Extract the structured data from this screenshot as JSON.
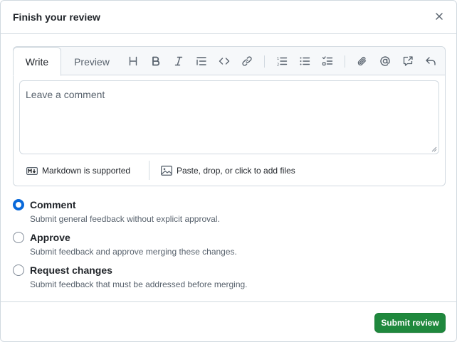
{
  "dialog": {
    "title": "Finish your review",
    "close_icon": "close-icon"
  },
  "editor": {
    "tabs": [
      {
        "label": "Write",
        "active": true
      },
      {
        "label": "Preview",
        "active": false
      }
    ],
    "toolbar": [
      "heading-icon",
      "bold-icon",
      "italic-icon",
      "quote-icon",
      "code-icon",
      "link-icon",
      "ordered-list-icon",
      "unordered-list-icon",
      "task-list-icon",
      "attach-icon",
      "mention-icon",
      "cross-reference-icon",
      "reply-icon"
    ],
    "textarea": {
      "placeholder": "Leave a comment",
      "value": ""
    },
    "footer": {
      "markdown_label": "Markdown is supported",
      "attach_label": "Paste, drop, or click to add files"
    }
  },
  "review_options": [
    {
      "label": "Comment",
      "description": "Submit general feedback without explicit approval.",
      "checked": true
    },
    {
      "label": "Approve",
      "description": "Submit feedback and approve merging these changes.",
      "checked": false
    },
    {
      "label": "Request changes",
      "description": "Submit feedback that must be addressed before merging.",
      "checked": false
    }
  ],
  "actions": {
    "submit_label": "Submit review"
  },
  "colors": {
    "accent": "#0969da",
    "submit_bg": "#1f883d",
    "border": "#d1d9e0",
    "muted_text": "#59636e"
  }
}
